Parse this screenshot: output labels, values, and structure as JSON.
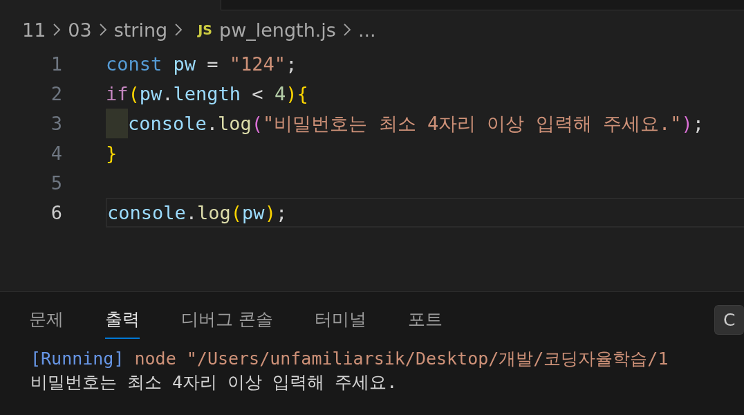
{
  "breadcrumb": [
    {
      "label": "11"
    },
    {
      "label": "03"
    },
    {
      "label": "string"
    },
    {
      "label": "pw_length.js",
      "badge": "JS"
    },
    {
      "label": "..."
    }
  ],
  "editor": {
    "lines": [
      {
        "number": "1",
        "current": false,
        "indent_highlight": false,
        "tokens": [
          {
            "t": "const",
            "kind": "keyword"
          },
          {
            "t": " pw",
            "kind": "variable"
          },
          {
            "t": " = ",
            "kind": "plain"
          },
          {
            "t": "\"124\"",
            "kind": "string"
          },
          {
            "t": ";",
            "kind": "plain"
          }
        ]
      },
      {
        "number": "2",
        "current": false,
        "indent_highlight": false,
        "tokens": [
          {
            "t": "if",
            "kind": "control"
          },
          {
            "t": "(",
            "kind": "bracket1"
          },
          {
            "t": "pw",
            "kind": "variable"
          },
          {
            "t": ".",
            "kind": "plain"
          },
          {
            "t": "length",
            "kind": "variable"
          },
          {
            "t": " < ",
            "kind": "plain"
          },
          {
            "t": "4",
            "kind": "number"
          },
          {
            "t": ")",
            "kind": "bracket1"
          },
          {
            "t": "{",
            "kind": "bracket1"
          }
        ]
      },
      {
        "number": "3",
        "current": false,
        "indent_highlight": true,
        "tokens": [
          {
            "t": "console",
            "kind": "variable"
          },
          {
            "t": ".",
            "kind": "plain"
          },
          {
            "t": "log",
            "kind": "function"
          },
          {
            "t": "(",
            "kind": "bracket2"
          },
          {
            "t": "\"비밀번호는 최소 4자리 이상 입력해 주세요.\"",
            "kind": "string"
          },
          {
            "t": ")",
            "kind": "bracket2"
          },
          {
            "t": ";",
            "kind": "plain"
          }
        ]
      },
      {
        "number": "4",
        "current": false,
        "indent_highlight": false,
        "tokens": [
          {
            "t": "}",
            "kind": "bracket1"
          }
        ]
      },
      {
        "number": "5",
        "current": false,
        "indent_highlight": false
      },
      {
        "number": "6",
        "current": true,
        "indent_highlight": false,
        "tokens": [
          {
            "t": "console",
            "kind": "variable"
          },
          {
            "t": ".",
            "kind": "plain"
          },
          {
            "t": "log",
            "kind": "function"
          },
          {
            "t": "(",
            "kind": "bracket1"
          },
          {
            "t": "pw",
            "kind": "variable"
          },
          {
            "t": ")",
            "kind": "bracket1"
          },
          {
            "t": ";",
            "kind": "plain"
          }
        ]
      }
    ]
  },
  "panel": {
    "tabs": [
      {
        "label": "문제",
        "selected": false
      },
      {
        "label": "출력",
        "selected": true
      },
      {
        "label": "디버그 콘솔",
        "selected": false
      },
      {
        "label": "터미널",
        "selected": false
      },
      {
        "label": "포트",
        "selected": false
      }
    ],
    "dropdown": "C",
    "output": [
      [
        {
          "t": "[Running]",
          "kind": "info"
        },
        {
          "t": " node \"/Users/unfamiliarsik/Desktop/개발/코딩자율학습/1",
          "kind": "string"
        }
      ],
      [
        {
          "t": "비밀번호는 최소 4자리 이상 입력해 주세요.",
          "kind": "plain"
        }
      ]
    ]
  }
}
